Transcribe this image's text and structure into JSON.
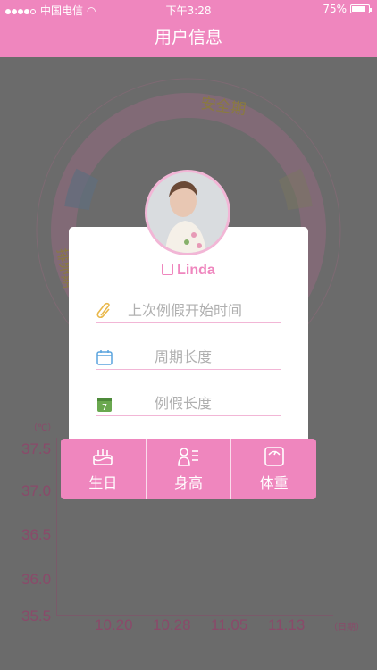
{
  "status_bar": {
    "carrier": "中国电信",
    "time": "下午3:28",
    "battery": "75%"
  },
  "nav": {
    "title": "用户信息"
  },
  "background": {
    "ring_label_safe": "安全期",
    "ring_label_ovulation": "排卵期",
    "chart_data": {
      "type": "line",
      "ylabel": "（℃）",
      "xlabel": "（日期）",
      "y_ticks": [
        "37.5",
        "37.0",
        "36.5",
        "36.0",
        "35.5"
      ],
      "x_ticks": [
        "10.20",
        "10.28",
        "11.05",
        "11.13"
      ],
      "ylim": [
        35.5,
        37.5
      ],
      "series": []
    }
  },
  "profile": {
    "username": "Linda",
    "fields": {
      "last_period": {
        "placeholder": "上次例假开始时间",
        "value": ""
      },
      "cycle_length": {
        "placeholder": "周期长度",
        "value": ""
      },
      "period_length": {
        "placeholder": "例假长度",
        "value": ""
      }
    },
    "tabs": [
      {
        "label": "生日",
        "icon": "cake-icon"
      },
      {
        "label": "身高",
        "icon": "height-icon"
      },
      {
        "label": "体重",
        "icon": "scale-icon"
      }
    ]
  },
  "colors": {
    "accent": "#ef86be",
    "overlay": "#6b6b6b"
  }
}
